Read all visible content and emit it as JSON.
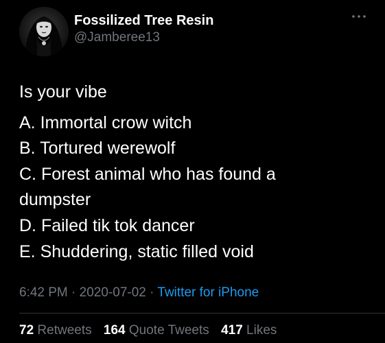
{
  "author": {
    "name": "Fossilized Tree Resin",
    "handle": "@Jamberee13",
    "avatar_icon": "profile-photo"
  },
  "more_icon": "ellipsis-icon",
  "tweet": {
    "intro": "Is your vibe",
    "options": [
      "A. Immortal crow witch",
      "B. Tortured werewolf",
      "C. Forest animal who has found a",
      "dumpster",
      "D. Failed tik tok dancer",
      "E. Shuddering, static filled void"
    ]
  },
  "meta": {
    "time": "6:42 PM",
    "separator": "·",
    "date": "2020-07-02",
    "source": "Twitter for iPhone"
  },
  "stats": {
    "retweets_count": "72",
    "retweets_label": "Retweets",
    "quotes_count": "164",
    "quotes_label": "Quote Tweets",
    "likes_count": "417",
    "likes_label": "Likes"
  },
  "colors": {
    "background": "#000000",
    "text_primary": "#ffffff",
    "text_secondary": "#71767b",
    "link": "#1d9bf0",
    "divider": "#2f3336"
  }
}
